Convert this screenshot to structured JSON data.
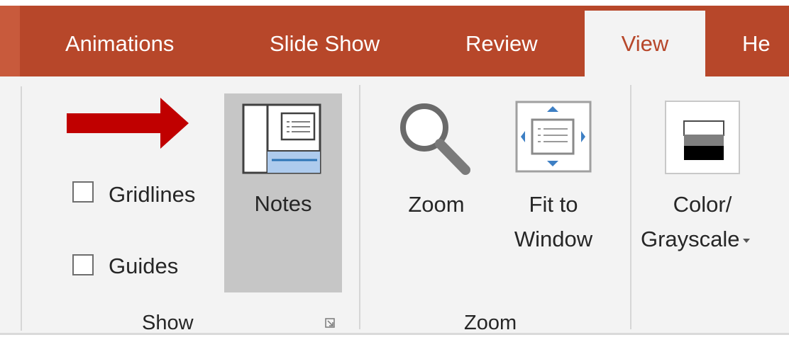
{
  "tabs": {
    "animations": "Animations",
    "slide_show": "Slide Show",
    "review": "Review",
    "view": "View",
    "help_partial": "He"
  },
  "show_group": {
    "gridlines_label": "Gridlines",
    "guides_label": "Guides",
    "notes_label": "Notes",
    "group_label": "Show"
  },
  "zoom_group": {
    "zoom_label": "Zoom",
    "fit_line1": "Fit to",
    "fit_line2": "Window",
    "group_label": "Zoom"
  },
  "color_group": {
    "line1": "Color/",
    "line2": "Grayscale"
  },
  "icons": {
    "annotation": "red-arrow-icon",
    "notes": "notes-page-icon",
    "zoom": "magnifier-icon",
    "fit": "fit-to-window-icon",
    "color": "color-grayscale-icon",
    "launcher": "dialog-launcher-icon"
  },
  "colors": {
    "tab_bar": "#b7472a",
    "ribbon": "#f3f3f3",
    "arrow": "#c00000",
    "selected_button": "#c6c6c6",
    "accent_blue": "#2e75b6"
  }
}
